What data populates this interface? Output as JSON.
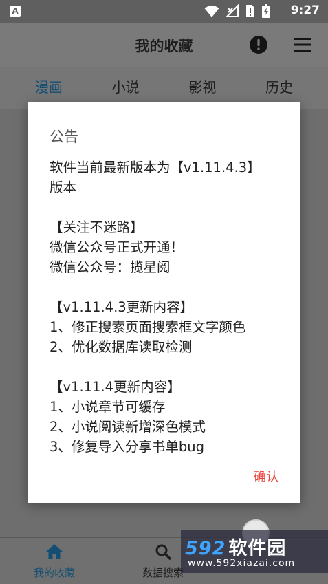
{
  "status_bar": {
    "app_icon": "A",
    "time": "9:27"
  },
  "header": {
    "title": "我的收藏"
  },
  "tabs": [
    {
      "label": "漫画",
      "active": true
    },
    {
      "label": "小说",
      "active": false
    },
    {
      "label": "影视",
      "active": false
    },
    {
      "label": "历史",
      "active": false
    }
  ],
  "dialog": {
    "title": "公告",
    "lines": [
      "软件当前最新版本为【v1.11.4.3】",
      "版本",
      "",
      "【关注不迷路】",
      "微信公众号正式开通！",
      "微信公众号：揽星阅",
      "",
      "【v1.11.4.3更新内容】",
      "1、修正搜索页面搜索框文字颜色",
      "2、优化数据库读取检测",
      "",
      "【v1.11.4更新内容】",
      "1、小说章节可缓存",
      "2、小说阅读新增深色模式",
      "3、修复导入分享书单bug"
    ],
    "confirm_label": "确认"
  },
  "bottom_nav": [
    {
      "label": "我的收藏",
      "icon": "home-icon",
      "active": true
    },
    {
      "label": "数据搜索",
      "icon": "search-icon",
      "active": false
    }
  ],
  "watermark": {
    "brand_number": "592",
    "brand_text": "软件园",
    "url": "www.592xiazai.com"
  },
  "colors": {
    "accent": "#144f73",
    "confirm": "#e8453c",
    "watermark_blue": "#3da4ff"
  }
}
